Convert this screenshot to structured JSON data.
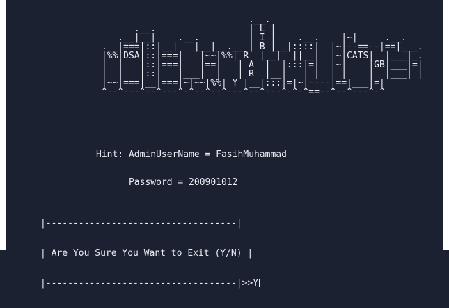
{
  "art_lines": [
    "                            .__.",
    "       .__.                 | L |",
    "    .__|__|    .__.         | I |    .__.    |~|     .__.",
    " .__|===|::|__|   |__|__.__ | B |__|::::|  |~|--==--|==|___.",
    " |%%|DSA|::|===|   |~~|%%| R  |__|  ||__|  |~|CATS|  |___|_.",
    " |  |   |::|===|   |==|   | A  |  |:::|=|  |~|    |GB|___|=|",
    " |  |   |::|   |___|  |   | R  |__|   | |  | |    |  |___| |",
    " |~~|===|__|===|~|~~|%%| Y |__|:::|=|~|----|==|___|=|",
    " ^--^---^--^---^-^--^--^---^--^---^-^-^==--^--^---^-^"
  ],
  "hint": {
    "line1": "Hint: AdminUserName = FasihMuhammad",
    "line2": "      Password = 200901012"
  },
  "dialog": {
    "top": "|-----------------------------------|",
    "message": "| Are You Sure You Want to Exit (Y/N) |",
    "bottom": "|-----------------------------------|",
    "prompt": ">>Y"
  }
}
